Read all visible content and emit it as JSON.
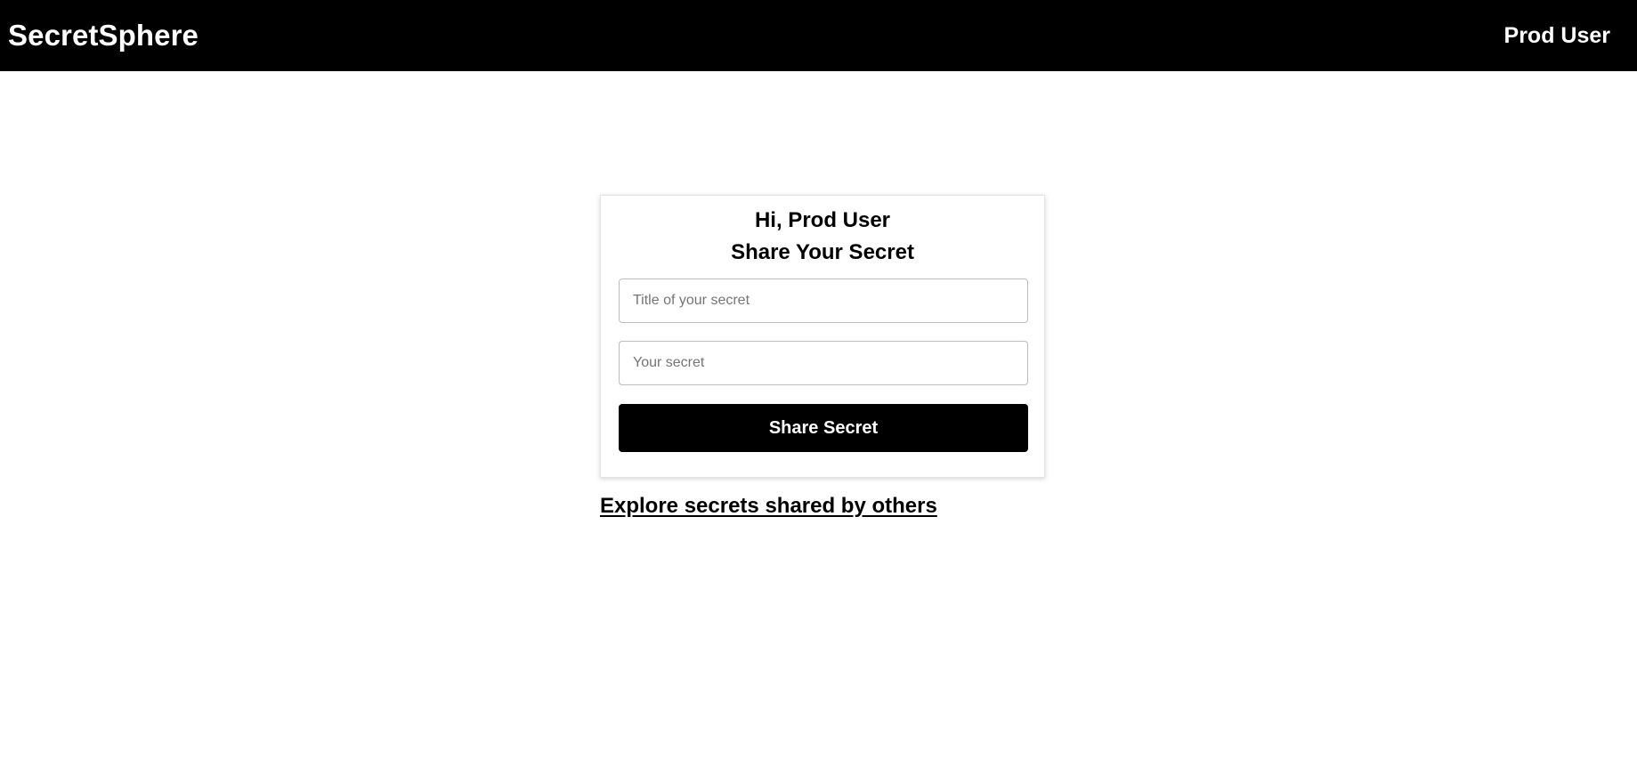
{
  "navbar": {
    "brand": "SecretSphere",
    "user_name": "Prod User"
  },
  "card": {
    "greeting": "Hi, Prod User",
    "title": "Share Your Secret",
    "title_field": {
      "placeholder": "Title of your secret",
      "value": ""
    },
    "secret_field": {
      "placeholder": "Your secret",
      "value": ""
    },
    "submit_label": "Share Secret"
  },
  "explore_link": "Explore secrets shared by others",
  "colors": {
    "navbar_bg": "#000000",
    "navbar_text": "#ffffff",
    "button_bg": "#000000",
    "page_bg": "#ffffff"
  }
}
